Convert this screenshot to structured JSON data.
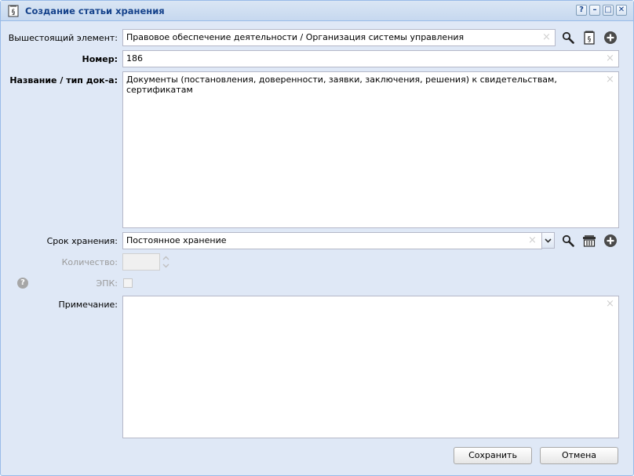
{
  "window": {
    "title": "Создание статьи хранения",
    "tools": {
      "help": "?",
      "minimize": "–",
      "maximize": "□",
      "close": "✕"
    }
  },
  "form": {
    "parent": {
      "label": "Вышестоящий элемент:",
      "value": "Правовое обеспечение деятельности / Организация системы управления"
    },
    "number": {
      "label": "Номер:",
      "value": "186"
    },
    "name": {
      "label": "Название / тип док-а:",
      "value": "Документы (постановления, доверенности, заявки, заключения, решения) к свидетельствам, сертификатам"
    },
    "retention": {
      "label": "Срок хранения:",
      "value": "Постоянное хранение"
    },
    "quantity": {
      "label": "Количество:",
      "value": ""
    },
    "epk": {
      "label": "ЭПК:",
      "checked": false
    },
    "note": {
      "label": "Примечание:",
      "value": ""
    }
  },
  "buttons": {
    "save": "Сохранить",
    "cancel": "Отмена"
  },
  "icons": {
    "help": "?",
    "clear": "×"
  },
  "colors": {
    "title": "#15428b",
    "frame": "#99bbe8",
    "body": "#dfe8f6"
  }
}
